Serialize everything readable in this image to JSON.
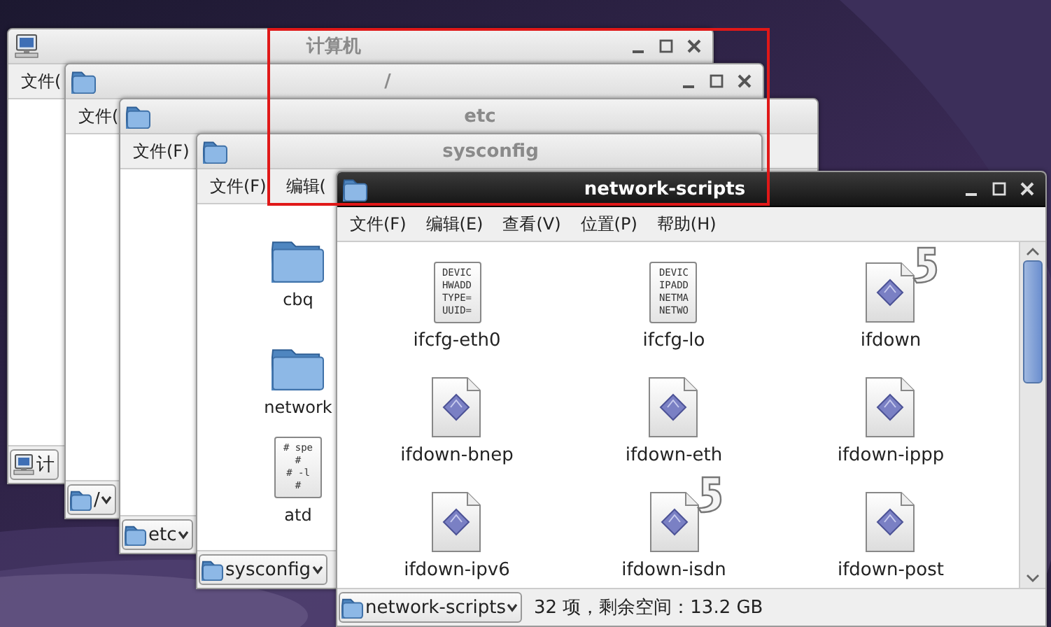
{
  "windows": [
    {
      "title": "计算机",
      "active": false,
      "window_buttons": true,
      "menu": [
        "文件("
      ],
      "scrollbar": false,
      "location": {
        "label": "计",
        "dropdown": false
      }
    },
    {
      "title": "/",
      "active": false,
      "window_buttons": true,
      "menu": [
        "文件("
      ],
      "scrollbar": false,
      "location": {
        "label": "/",
        "dropdown": true
      }
    },
    {
      "title": "etc",
      "active": false,
      "window_buttons": false,
      "menu": [
        "文件(F)"
      ],
      "scrollbar": false,
      "location": {
        "label": "etc",
        "dropdown": true
      }
    },
    {
      "title": "sysconfig",
      "active": false,
      "window_buttons": false,
      "menu": [
        "文件(F)",
        "编辑("
      ],
      "files": [
        {
          "name": "cbq",
          "kind": "folder",
          "link": false
        },
        {
          "name": "network",
          "kind": "folder",
          "link": false
        },
        {
          "name": "atd",
          "kind": "text",
          "link": false,
          "preview": [
            "# spe",
            "#",
            "# -l",
            "#"
          ]
        }
      ],
      "scrollbar": false,
      "location": {
        "label": "sysconfig",
        "dropdown": true
      }
    },
    {
      "title": "network-scripts",
      "active": true,
      "window_buttons": true,
      "menu": [
        "文件(F)",
        "编辑(E)",
        "查看(V)",
        "位置(P)",
        "帮助(H)"
      ],
      "files": [
        {
          "name": "ifcfg-eth0",
          "kind": "text",
          "link": false,
          "preview": [
            "DEVIC",
            "HWADD",
            "TYPE=",
            "UUID="
          ]
        },
        {
          "name": "ifcfg-lo",
          "kind": "text",
          "link": false,
          "preview": [
            "DEVIC",
            "IPADD",
            "NETMA",
            "NETWO"
          ]
        },
        {
          "name": "ifdown",
          "kind": "script",
          "link": true
        },
        {
          "name": "ifdown-bnep",
          "kind": "script",
          "link": false
        },
        {
          "name": "ifdown-eth",
          "kind": "script",
          "link": false
        },
        {
          "name": "ifdown-ippp",
          "kind": "script",
          "link": false
        },
        {
          "name": "ifdown-ipv6",
          "kind": "script",
          "link": false
        },
        {
          "name": "ifdown-isdn",
          "kind": "script",
          "link": true
        },
        {
          "name": "ifdown-post",
          "kind": "script",
          "link": false
        }
      ],
      "scrollbar": true,
      "location": {
        "label": "network-scripts",
        "dropdown": true
      },
      "status": "32 项，剩余空间：13.2 GB"
    }
  ],
  "annotation": {
    "kind": "rectangle"
  }
}
